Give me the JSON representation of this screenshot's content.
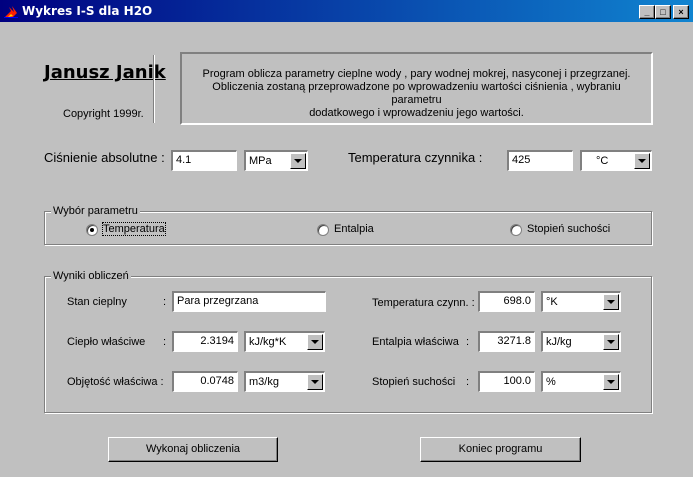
{
  "window": {
    "title": "Wykres I-S dla H2O",
    "controls": {
      "minimize": "_",
      "maximize": "□",
      "close": "×"
    }
  },
  "header": {
    "author": "Janusz Janik",
    "copyright": "Copyright 1999r.",
    "description": [
      "Program oblicza parametry cieplne wody , pary wodnej mokrej, nasyconej i przegrzanej.",
      "Obliczenia zostaną przeprowadzone po wprowadzeniu wartości ciśnienia , wybraniu parametru",
      "dodatkowego i wprowadzeniu jego wartości."
    ]
  },
  "inputs": {
    "pressure": {
      "label": "Ciśnienie absolutne :",
      "value": "4.1",
      "unit": "MPa"
    },
    "temperature": {
      "label": "Temperatura czynnika :",
      "value": "425",
      "unit": "°C"
    }
  },
  "parameter_group": {
    "title": "Wybór parametru",
    "options": [
      {
        "label": "Temperatura",
        "selected": true
      },
      {
        "label": "Entalpia",
        "selected": false
      },
      {
        "label": "Stopień suchości",
        "selected": false
      }
    ]
  },
  "results": {
    "title": "Wyniki obliczeń",
    "state": {
      "label": "Stan cieplny",
      "colon": ":",
      "value": "Para przegrzana"
    },
    "specific_heat": {
      "label": "Ciepło właściwe",
      "colon": ":",
      "value": "2.3194",
      "unit": "kJ/kg*K"
    },
    "specific_volume": {
      "label": "Objętość właściwa :",
      "value": "0.0748",
      "unit": "m3/kg"
    },
    "temperature": {
      "label": "Temperatura czynn. :",
      "value": "698.0",
      "unit": "°K"
    },
    "enthalpy": {
      "label": "Entalpia właściwa",
      "colon": ":",
      "value": "3271.8",
      "unit": "kJ/kg"
    },
    "dryness": {
      "label": "Stopień suchości",
      "colon": ":",
      "value": "100.0",
      "unit": "%"
    }
  },
  "buttons": {
    "compute": "Wykonaj obliczenia",
    "exit": "Koniec programu"
  },
  "icons": {
    "app": "flame-icon"
  },
  "colors": {
    "title_start": "#000080",
    "title_end": "#1084d0",
    "face": "#c0c0c0"
  }
}
